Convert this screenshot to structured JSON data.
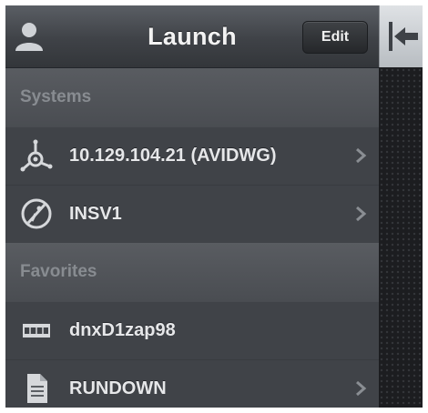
{
  "navbar": {
    "title": "Launch",
    "edit_label": "Edit",
    "user_icon": "user-icon",
    "back_icon": "arrow-back-icon"
  },
  "sections": [
    {
      "header": "Systems",
      "items": [
        {
          "label": "10.129.104.21 (AVIDWG)",
          "icon": "network-system-icon",
          "has_chevron": true
        },
        {
          "label": "INSV1",
          "icon": "interplay-icon",
          "has_chevron": true
        }
      ]
    },
    {
      "header": "Favorites",
      "items": [
        {
          "label": "dnxD1zap98",
          "icon": "clip-icon",
          "has_chevron": false
        },
        {
          "label": "RUNDOWN",
          "icon": "document-icon",
          "has_chevron": true
        }
      ]
    }
  ],
  "colors": {
    "background": "#3a3d42",
    "text": "#e6e7e9",
    "section_text": "#888c91"
  }
}
